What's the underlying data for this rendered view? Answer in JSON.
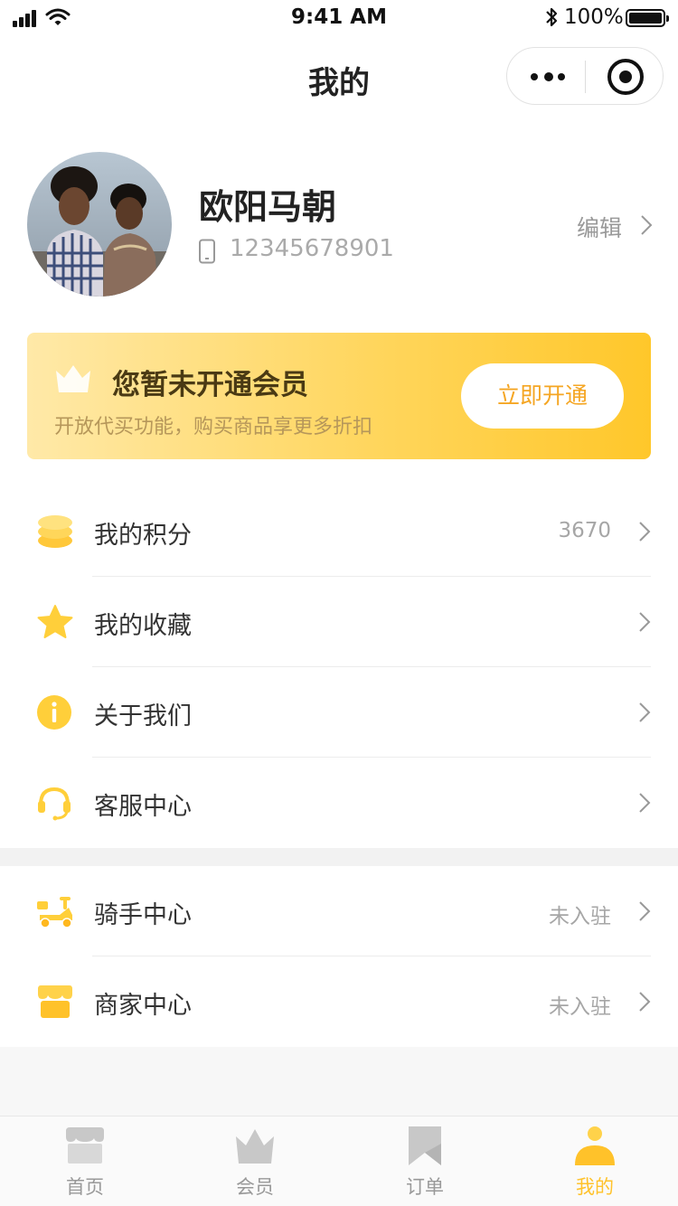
{
  "status_bar": {
    "time": "9:41 AM",
    "battery": "100%"
  },
  "nav": {
    "title": "我的"
  },
  "profile": {
    "name": "欧阳马朝",
    "phone": "12345678901",
    "edit_label": "编辑"
  },
  "member": {
    "title": "您暂未开通会员",
    "subtitle": "开放代买功能，购买商品享更多折扣",
    "button_label": "立即开通"
  },
  "menu_group_1": [
    {
      "label": "我的积分",
      "value": "3670",
      "icon": "coins-icon"
    },
    {
      "label": "我的收藏",
      "value": "",
      "icon": "star-icon"
    },
    {
      "label": "关于我们",
      "value": "",
      "icon": "info-icon"
    },
    {
      "label": "客服中心",
      "value": "",
      "icon": "headset-icon"
    }
  ],
  "menu_group_2": [
    {
      "label": "骑手中心",
      "value": "未入驻",
      "icon": "scooter-icon"
    },
    {
      "label": "商家中心",
      "value": "未入驻",
      "icon": "store-icon"
    }
  ],
  "tabbar": [
    {
      "label": "首页",
      "icon": "store-icon",
      "active": false
    },
    {
      "label": "会员",
      "icon": "crown-icon",
      "active": false
    },
    {
      "label": "订单",
      "icon": "bookmark-icon",
      "active": false
    },
    {
      "label": "我的",
      "icon": "person-icon",
      "active": true
    }
  ],
  "colors": {
    "accent": "#ffc22a",
    "accent_text": "#f5a623",
    "inactive_tab": "#999999",
    "member_title": "#4a3a14"
  }
}
